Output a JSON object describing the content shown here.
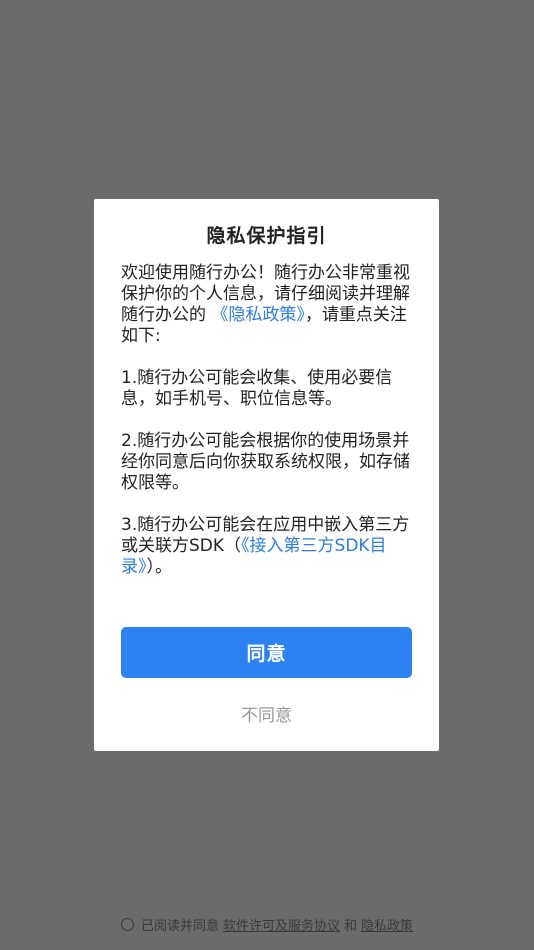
{
  "dialog": {
    "title": "隐私保护指引",
    "intro_part1": "欢迎使用随行办公！随行办公非常重视保护你的个人信息，请仔细阅读并理解随行办公的",
    "intro_link": "《隐私政策》",
    "intro_part2": "，请重点关注如下:",
    "item1": "1.随行办公可能会收集、使用必要信息，如手机号、职位信息等。",
    "item2": "2.随行办公可能会根据你的使用场景并经你同意后向你获取系统权限，如存储权限等。",
    "item3_part1": "3.随行办公可能会在应用中嵌入第三方或关联方SDK（",
    "item3_link": "《接入第三方SDK目录》",
    "item3_part2": "）。",
    "agree_label": "同意",
    "disagree_label": "不同意"
  },
  "footer": {
    "prefix": "已阅读并同意",
    "license_link": "软件许可及服务协议",
    "and": "和",
    "privacy_link": "隐私政策"
  },
  "colors": {
    "overlay": "#6b6b6b",
    "accent": "#2c82f0",
    "link": "#2f7de1"
  }
}
